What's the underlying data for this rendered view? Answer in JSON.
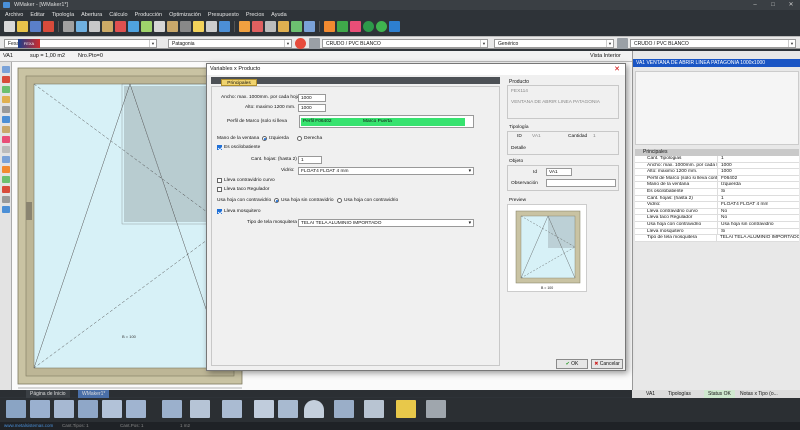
{
  "window": {
    "title": "WMaker - [WMaker1*]"
  },
  "menu": [
    "Archivo",
    "Editar",
    "Tipología",
    "Abertura",
    "Cálculo",
    "Producción",
    "Optimización",
    "Presupuesto",
    "Precios",
    "Ayuda"
  ],
  "selectors": {
    "line": "Fexa",
    "system": "Patagonia",
    "profile_color": "CRUDO / PVC BLANCO",
    "glass": "Genérico",
    "glass_color": "CRUDO / PVC BLANCO"
  },
  "doc": {
    "code": "VA1",
    "surface": "sup = 1,00 m2",
    "piece_no": "Nro.Pto=0",
    "view": "Vista Interior",
    "dim_bottom": "B = 100"
  },
  "dialog": {
    "title": "Variables x Producto",
    "tab": "Principales",
    "fields": {
      "width_label": "Ancho: max. 1000mm. por cada hoja",
      "width_value": "1000",
      "height_label": "Alto: maximo 1200 mm.",
      "height_value": "1000",
      "frame_label": "Perfil de Marco (solo si lleva",
      "frame_code": "Perfil F06402",
      "frame_name": "Marco Puerta",
      "hand_label": "Mano de la ventana",
      "hand_left": "Izquierda",
      "hand_right": "Derecha",
      "tilt_label": "Es oscilobatiente",
      "sheets_label": "Cant. hojas: (hasta 2)",
      "sheets_value": "1",
      "glass_label": "Vidrio:",
      "glass_value": "FLOAT4 FLOAT 4 mm",
      "curved_label": "Lleva contravidrio curvo",
      "taco_label": "Lleva taco Regulador",
      "contra_label": "Usa hoja con contravidrio",
      "contra_opt1": "Usa hoja sin contravidrio",
      "contra_opt2": "Usa hoja con contravidrio",
      "mesh_label": "Lleva mosquitero",
      "mesh_type_label": "Tipo de tela mosquitera",
      "mesh_type_value": "TELAI  TELA ALUMINIO IMPORTADO"
    },
    "product": {
      "heading": "Producto",
      "code": "FEX114",
      "name": "VENTANA DE ABRIR LINEA PATAGONIA"
    },
    "typology": {
      "heading": "Tipología",
      "id_label": "ID",
      "id_value": "VA1",
      "qty_label": "Cantidad",
      "qty_value": "1",
      "detail_label": "Detalle"
    },
    "object": {
      "heading": "Objeto",
      "id_label": "Id",
      "id_value": "VA1",
      "obs_label": "Observación"
    },
    "preview": {
      "heading": "Preview",
      "dim": "B = 100"
    },
    "ok": "OK",
    "cancel": "Cancelar"
  },
  "right_panel": {
    "header": "VA1 VENTANA DE ABRIR LINEA PATAGONIA 1000x1000",
    "category": "Principales",
    "rows": [
      {
        "k": "Cant. Tipologias",
        "v": "1"
      },
      {
        "k": "Ancho: max. 1000mm. por cada h...",
        "v": "1000"
      },
      {
        "k": "Alto: maximo 1200 mm.",
        "v": "1000"
      },
      {
        "k": "Perfil de Marco (solo si lleva contr...",
        "v": "F06402"
      },
      {
        "k": "Mano de la ventana",
        "v": "Izquierda"
      },
      {
        "k": "Es oscilobatiente",
        "v": "Si"
      },
      {
        "k": "Cant. hojas: (hasta 2)",
        "v": "1"
      },
      {
        "k": "Vidrio:",
        "v": "FLOAT4 FLOAT 4 mm"
      },
      {
        "k": "Lleva contravidrio curvo",
        "v": "No"
      },
      {
        "k": "Lleva taco Regulador",
        "v": "No"
      },
      {
        "k": "Usa hoja con contravidrio",
        "v": "Usa hoja sin contravidrio"
      },
      {
        "k": "Lleva mosquitero",
        "v": "Si"
      },
      {
        "k": "Tipo de tela mosquitera",
        "v": "TELAI  TELA ALUMINIO IMPORTADO"
      }
    ],
    "tabs": [
      "VA1",
      "Tipologías",
      "Status OK",
      "Notas x Tipo (o..."
    ]
  },
  "page_tabs": [
    "Página de Inicio",
    "WMaker1*"
  ],
  "footer": [
    "www.metalsistemas.com",
    "Cant.Tipos: 1",
    "Cant.Pos: 1",
    "1 m2"
  ],
  "colors": {
    "accent": "#1a55c4",
    "highlight": "#37e36f",
    "frame": "#c9c3a3"
  }
}
